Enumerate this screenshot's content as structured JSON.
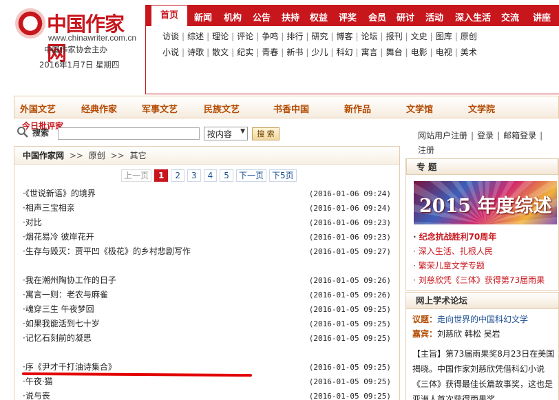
{
  "logo": {
    "name": "中国作家网",
    "url": "www.chinawriter.com.cn",
    "host": "中国作家协会主办",
    "date": "2016年1月7日  星期四"
  },
  "nav": {
    "primary": [
      "首页",
      "新闻",
      "机构",
      "公告",
      "扶持",
      "权益",
      "评奖",
      "会员",
      "研讨",
      "活动",
      "深入生活",
      "交流",
      "讲座"
    ],
    "row1": [
      "访谈",
      "综述",
      "理论",
      "评论",
      "争鸣",
      "排行",
      "研究",
      "博客",
      "论坛",
      "报刊",
      "文史",
      "图库",
      "原创"
    ],
    "row2": [
      "小说",
      "诗歌",
      "散文",
      "纪实",
      "青春",
      "新书",
      "少儿",
      "科幻",
      "寓言",
      "舞台",
      "电影",
      "电视",
      "美术"
    ]
  },
  "categories": [
    "外国文艺",
    "经典作家",
    "军事文艺",
    "民族文艺",
    "书香中国",
    "新作品",
    "文学馆",
    "文学院"
  ],
  "search": {
    "hot_label": "今日批评家",
    "label": "搜索",
    "select_value": "按内容",
    "button": "搜 索",
    "links": [
      "网站用户注册",
      "登录",
      "邮箱登录"
    ],
    "register": "注册"
  },
  "breadcrumb": {
    "home": "中国作家网",
    "sep": ">>",
    "items": [
      "原创",
      "其它"
    ]
  },
  "pager": {
    "prev": "上一页",
    "pages": [
      "1",
      "2",
      "3",
      "4",
      "5"
    ],
    "current": "1",
    "next": "下一页",
    "next5": "下5页"
  },
  "articles": [
    {
      "title": "·《世说新语》的境界",
      "date": "(2016-01-06 09:24)"
    },
    {
      "title": "·相声三宝相亲",
      "date": "(2016-01-06 09:24)"
    },
    {
      "title": "·对比",
      "date": "(2016-01-06 09:23)"
    },
    {
      "title": "·烟花易冷 彼岸花开",
      "date": "(2016-01-06 09:23)"
    },
    {
      "title": "·生存与毁灭：贾平凹《极花》的乡村悲剧写作",
      "date": "(2016-01-05 09:27)"
    },
    {
      "title": "·我在潮州陶协工作的日子",
      "date": "(2016-01-05 09:26)"
    },
    {
      "title": "·寓言一则：老农与麻雀",
      "date": "(2016-01-05 09:26)"
    },
    {
      "title": "·魂穿三生 午夜梦回",
      "date": "(2016-01-05 09:25)"
    },
    {
      "title": "·如果我能活到七十岁",
      "date": "(2016-01-05 09:25)"
    },
    {
      "title": "·记忆石刻前的凝思",
      "date": "(2016-01-05 09:25)"
    },
    {
      "title": "·序《尹才千打油诗集合》",
      "date": "(2016-01-05 09:25)"
    },
    {
      "title": "·午夜·猫",
      "date": "(2016-01-05 09:25)"
    },
    {
      "title": "·说与丧",
      "date": "(2016-01-05 09:25)"
    }
  ],
  "special": {
    "title": "专 题",
    "banner": "2015 年度综述",
    "items": [
      "纪念抗战胜利70周年",
      "深入生活、扎根人民",
      "繁荣儿童文学专题",
      "刘慈欣凭《三体》获得第73届雨果"
    ]
  },
  "forum": {
    "title": "网上学术论坛",
    "topic_key": "议题：",
    "topic_val": "走向世界的中国科幻文学",
    "guest_key": "嘉宾：",
    "guest_val": "刘慈欣   韩松   吴岩",
    "summary_tag": "【主旨】",
    "summary": "第73届雨果奖8月23日在美国揭晓。中国作家刘慈欣凭借科幻小说《三体》获得最佳长篇故事奖，这也是亚洲人首次获得雨果奖。"
  },
  "colors": {
    "brand": "#c8161d",
    "link": "#1a4e93",
    "category": "#b34b00",
    "annotation": "#e20000"
  }
}
